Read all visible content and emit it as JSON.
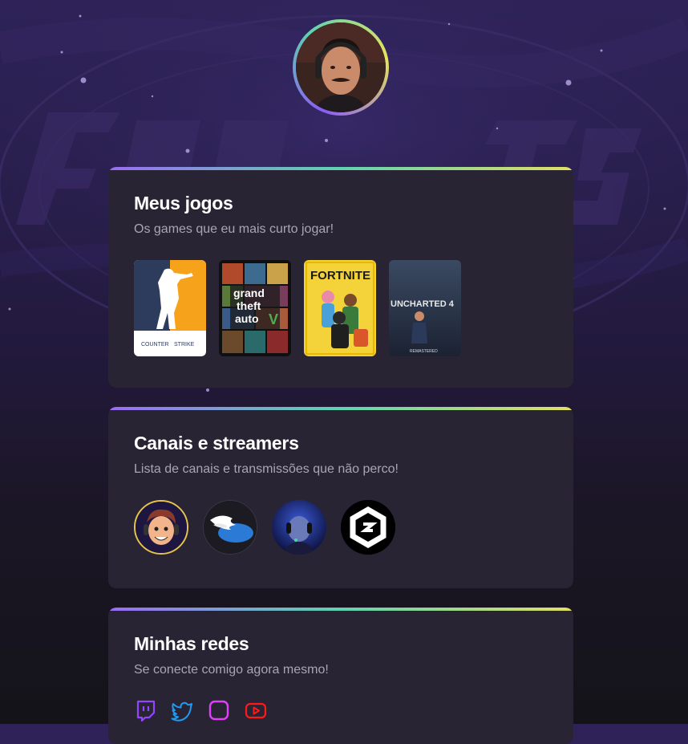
{
  "profile": {
    "avatar_alt": "profile-photo"
  },
  "games_section": {
    "title": "Meus jogos",
    "subtitle": "Os games que eu mais curto jogar!",
    "games": [
      {
        "name": "counter-strike",
        "label_top": "COUNTER",
        "label_bottom": "STRIKE"
      },
      {
        "name": "gta-v",
        "line1": "grand",
        "line2": "theft",
        "line3": "auto"
      },
      {
        "name": "fortnite",
        "label": "FORTNITE"
      },
      {
        "name": "uncharted-4",
        "label": "UNCHARTED 4",
        "sub": "REMASTERED"
      }
    ]
  },
  "channels_section": {
    "title": "Canais e streamers",
    "subtitle": "Lista de canais e transmissões que não perco!",
    "channels": [
      "cartoon-streamer",
      "wing-logo",
      "blue-streamer",
      "hexagon-logo"
    ]
  },
  "socials_section": {
    "title": "Minhas redes",
    "subtitle": "Se conecte comigo agora mesmo!",
    "icons": [
      "twitch-icon",
      "twitter-icon",
      "instagram-icon",
      "youtube-icon"
    ]
  },
  "colors": {
    "accent_purple": "#9a6cf5",
    "accent_green": "#5fd3b1",
    "accent_yellow": "#e2e064",
    "card_bg": "#292433",
    "twitch": "#9146ff",
    "twitter": "#1d9bf0",
    "instagram": "#e040fb",
    "youtube": "#ff0000"
  }
}
